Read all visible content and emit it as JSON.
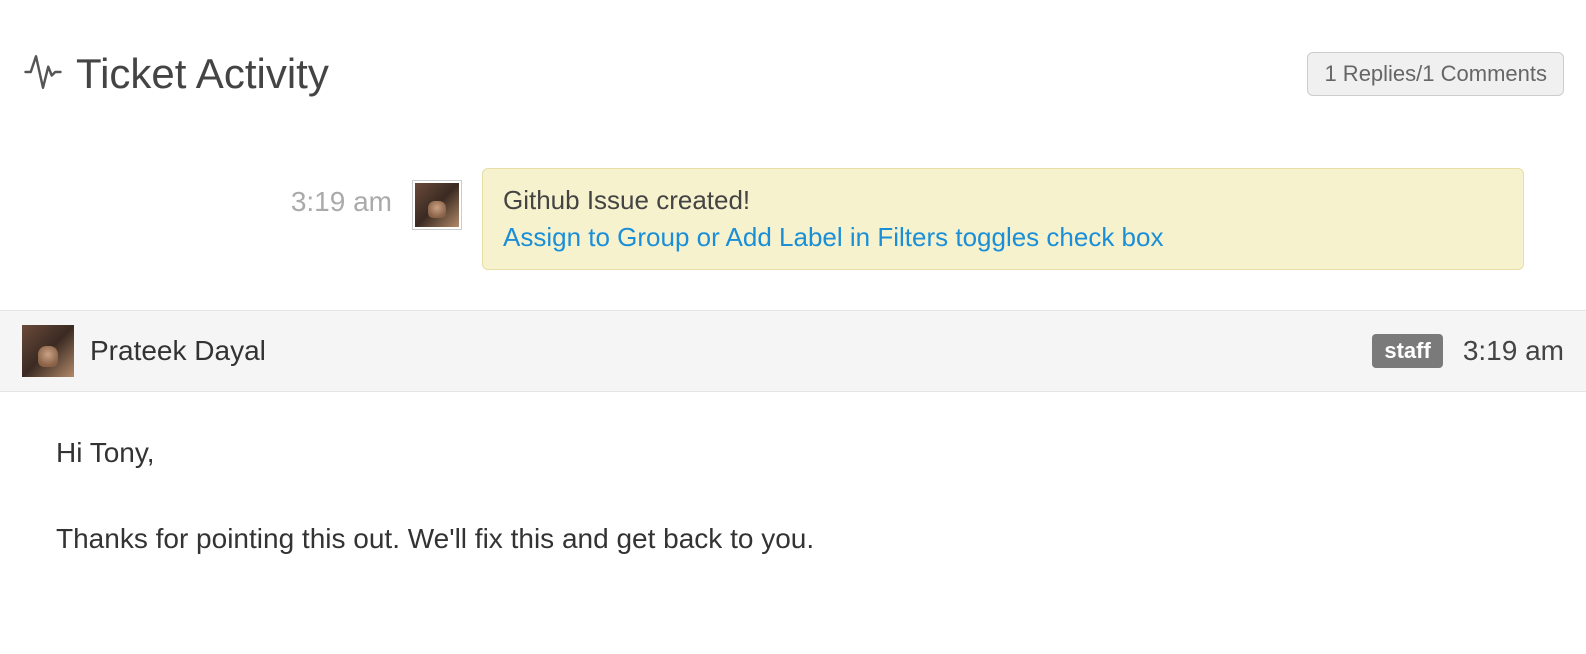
{
  "header": {
    "title": "Ticket Activity",
    "replies_badge": "1 Replies/1 Comments"
  },
  "event": {
    "time": "3:19 am",
    "callout_title": "Github Issue created!",
    "callout_link": "Assign to Group or Add Label in Filters toggles check box"
  },
  "reply": {
    "author": "Prateek Dayal",
    "role": "staff",
    "time": "3:19 am",
    "body_line1": "Hi Tony,",
    "body_line2": "Thanks for pointing this out. We'll fix this and get back to you."
  }
}
